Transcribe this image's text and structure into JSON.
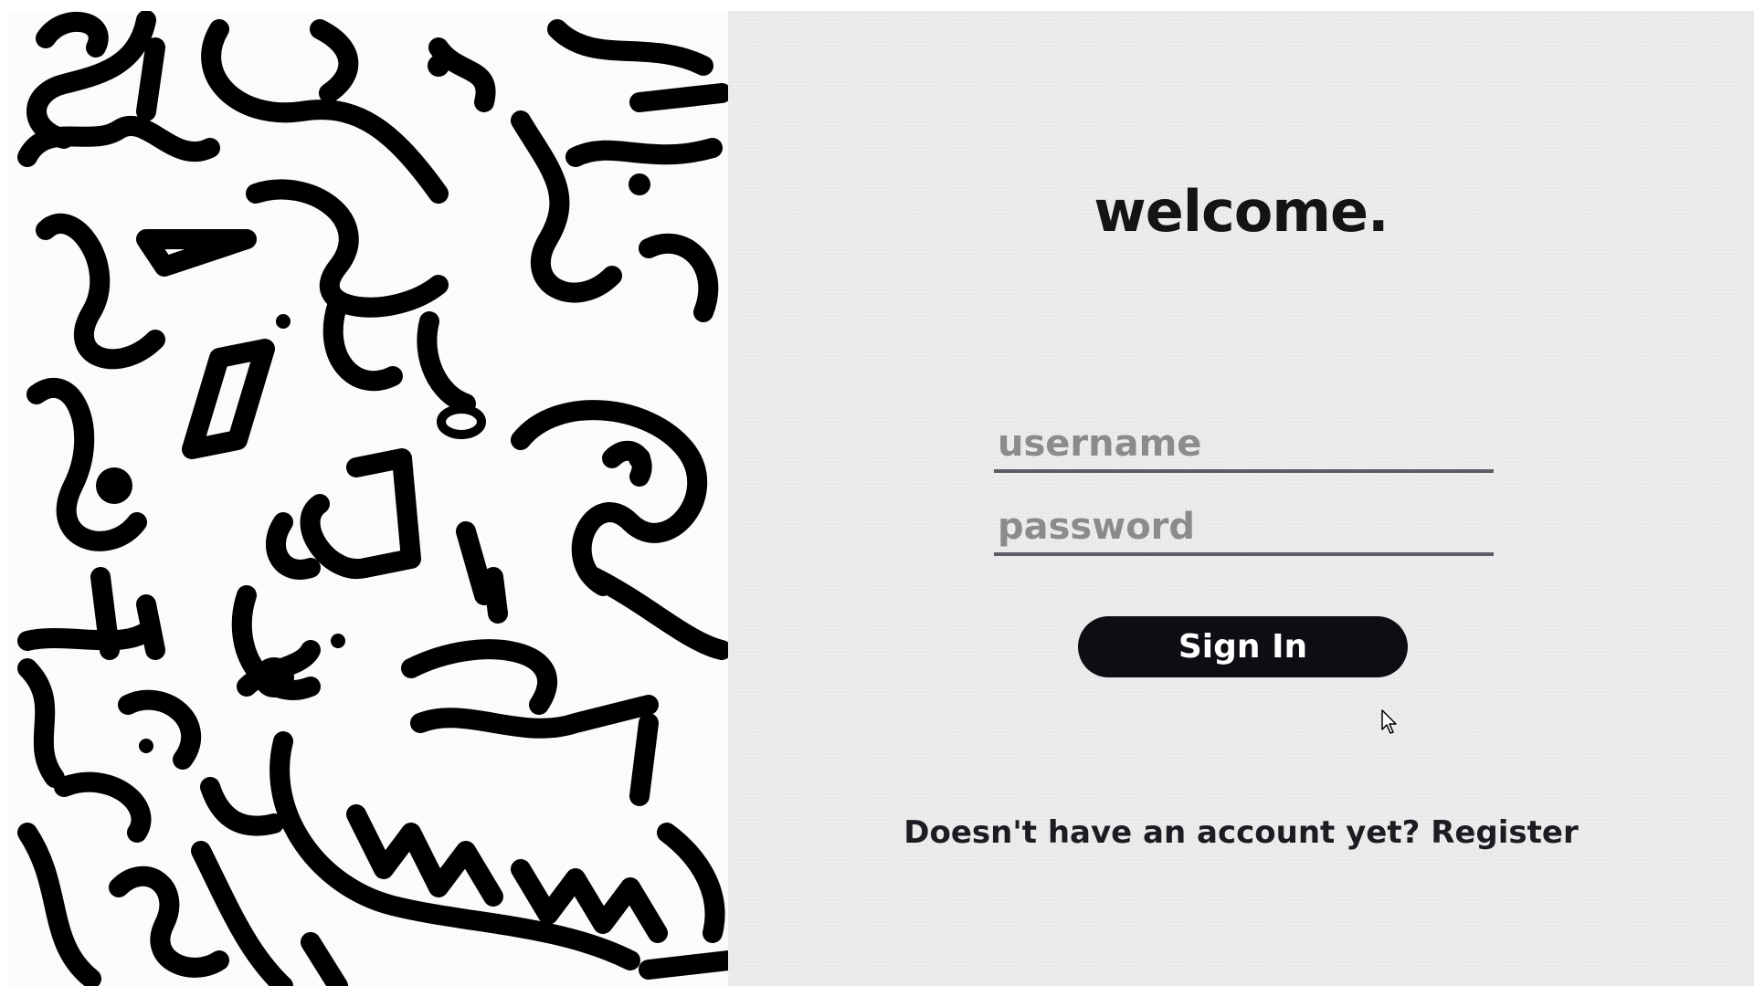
{
  "login": {
    "title": "welcome.",
    "username_placeholder": "username",
    "password_placeholder": "password",
    "sign_in_label": "Sign In",
    "register_prompt": "Doesn't have an account yet?",
    "register_link": "Register"
  },
  "art": {
    "icon": "abstract-doodle-pattern"
  },
  "colors": {
    "button_bg": "#0d0d14",
    "panel_bg": "#ececec",
    "underline": "#5d5d66"
  }
}
